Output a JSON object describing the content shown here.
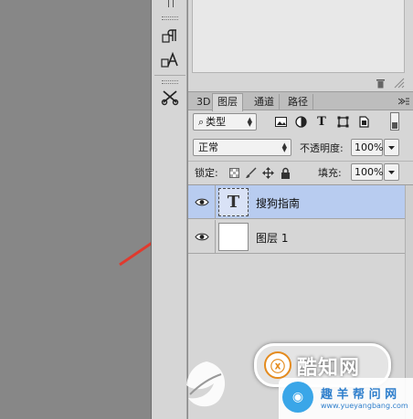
{
  "layers_panel": {
    "tabs": [
      {
        "label": "3D"
      },
      {
        "label": "图层"
      },
      {
        "label": "通道"
      },
      {
        "label": "路径"
      }
    ],
    "filter": {
      "value": "类型",
      "icons": [
        "image-filter-icon",
        "adjustment-filter-icon",
        "type-filter-icon",
        "shape-filter-icon",
        "smart-object-filter-icon"
      ]
    },
    "blend_mode": {
      "value": "正常"
    },
    "opacity": {
      "label": "不透明度:",
      "value": "100%"
    },
    "lock": {
      "label": "锁定:",
      "icons": [
        "lock-transparent-icon",
        "lock-paint-icon",
        "lock-move-icon",
        "lock-all-icon"
      ]
    },
    "fill": {
      "label": "填充:",
      "value": "100%"
    },
    "layers": [
      {
        "name": "搜狗指南",
        "thumb": "T",
        "selected": true
      },
      {
        "name": "图层 1",
        "thumb": "",
        "selected": false
      }
    ]
  },
  "watermark": {
    "badge_char": "ⓧ",
    "badge_text": "酷知网",
    "card_title": "趣 羊 帮 问 网",
    "card_url": "www.yueyangbang.com"
  },
  "colors": {
    "selected_row": "#b8ccf0",
    "arrow": "#e03a2e",
    "panel_bg": "#d6d6d6",
    "canvas_bg": "#878787"
  }
}
